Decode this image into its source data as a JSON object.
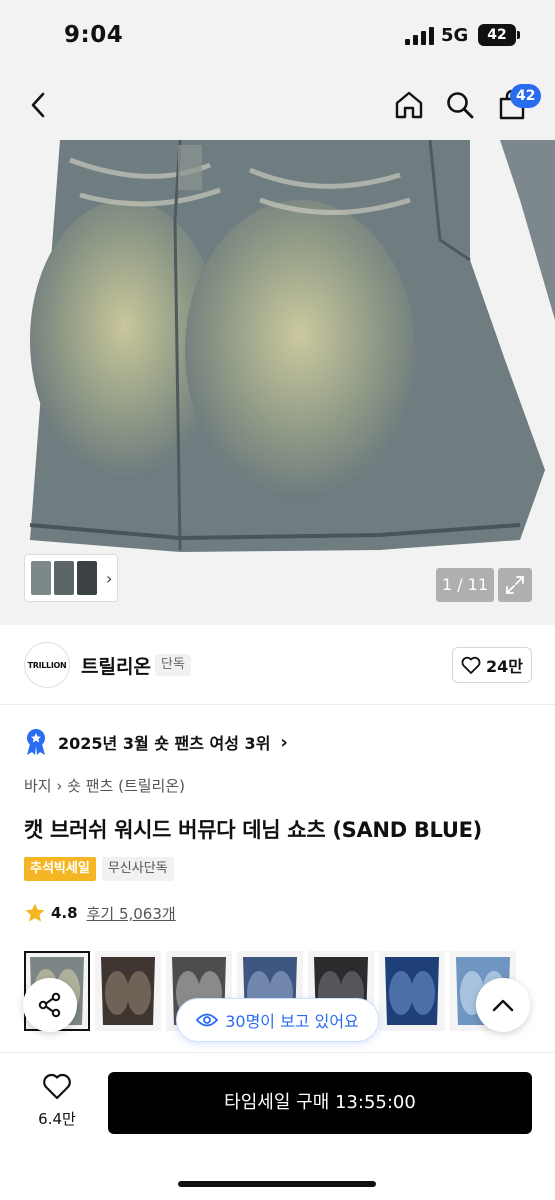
{
  "status_bar": {
    "time": "9:04",
    "network": "5G",
    "battery": "42"
  },
  "nav": {
    "cart_count": "42",
    "icons": [
      "back-icon",
      "home-icon",
      "search-icon",
      "cart-icon"
    ]
  },
  "gallery": {
    "counter": "1 / 11"
  },
  "brand": {
    "logo_text": "TRILLION",
    "name": "트릴리온",
    "tag": "단독",
    "likes": "24만"
  },
  "ranking": {
    "text": "2025년 3월 숏 팬츠 여성 3위"
  },
  "breadcrumb": {
    "category": "바지",
    "subcategory": "숏 팬츠 (트릴리온)"
  },
  "product": {
    "title": "캣 브러쉬 워시드 버뮤다 데님 쇼츠 (SAND BLUE)",
    "badges": [
      "추석빅세일",
      "무신사단독"
    ],
    "rating": "4.8",
    "reviews": "후기 5,063개"
  },
  "viewers": {
    "text": "30명이 보고 있어요"
  },
  "bottom": {
    "like_count": "6.4만",
    "buy_label": "타임세일 구매 13:55:00"
  },
  "colors": {
    "accent": "#2a6cf0",
    "sale_badge": "#f4b624",
    "star": "#f4b624",
    "buy_button": "#000000"
  }
}
